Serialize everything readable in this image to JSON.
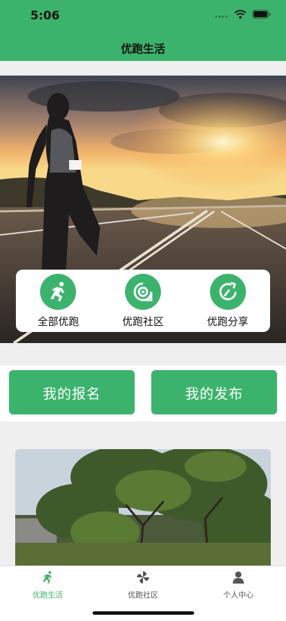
{
  "status_bar": {
    "time": "5:06"
  },
  "header": {
    "title": "优跑生活"
  },
  "quick_links": [
    {
      "label": "全部优跑",
      "icon": "runner-icon"
    },
    {
      "label": "优跑社区",
      "icon": "community-icon"
    },
    {
      "label": "优跑分享",
      "icon": "share-icon"
    }
  ],
  "buttons": {
    "my_signup": "我的报名",
    "my_posts": "我的发布"
  },
  "tabs": [
    {
      "label": "优跑生活",
      "icon": "runner-icon",
      "active": true
    },
    {
      "label": "优跑社区",
      "icon": "pinwheel-icon",
      "active": false
    },
    {
      "label": "个人中心",
      "icon": "person-icon",
      "active": false
    }
  ],
  "colors": {
    "accent": "#3cb36c",
    "background": "#efefef"
  }
}
